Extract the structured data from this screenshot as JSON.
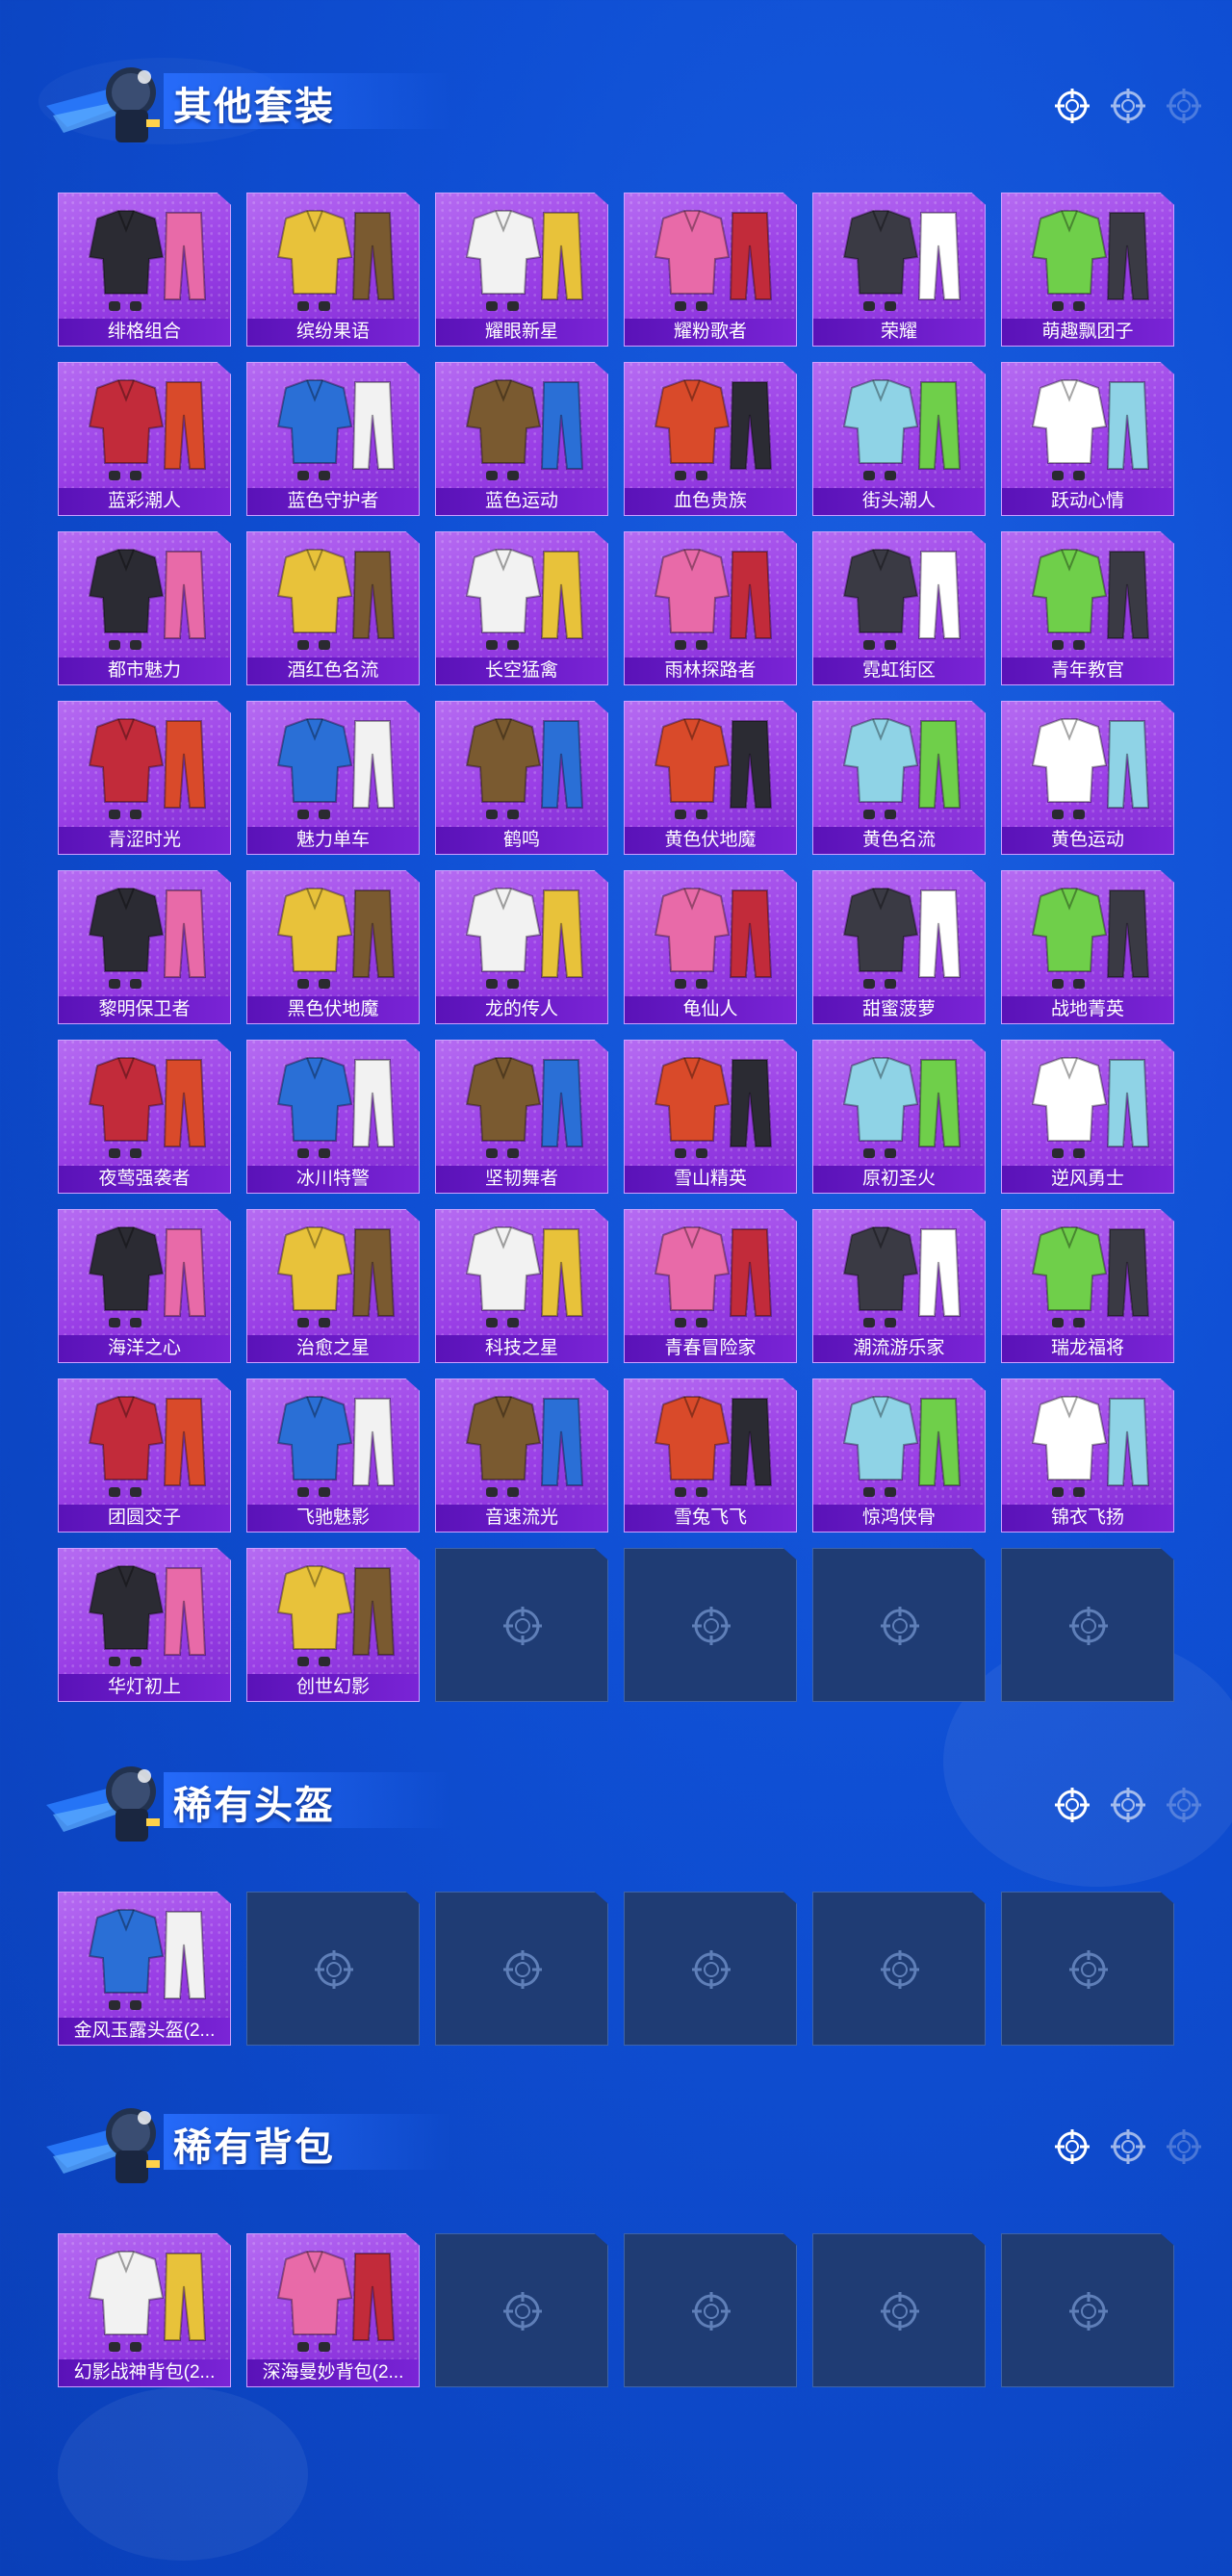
{
  "sections": [
    {
      "title": "其他套装",
      "items": [
        "绯格组合",
        "缤纷果语",
        "耀眼新星",
        "耀粉歌者",
        "荣耀",
        "萌趣飘团子",
        "蓝彩潮人",
        "蓝色守护者",
        "蓝色运动",
        "血色贵族",
        "街头潮人",
        "跃动心情",
        "都市魅力",
        "酒红色名流",
        "长空猛禽",
        "雨林探路者",
        "霓虹街区",
        "青年教官",
        "青涩时光",
        "魅力单车",
        "鹤鸣",
        "黄色伏地魔",
        "黄色名流",
        "黄色运动",
        "黎明保卫者",
        "黑色伏地魔",
        "龙的传人",
        "龟仙人",
        "甜蜜菠萝",
        "战地菁英",
        "夜莺强袭者",
        "冰川特警",
        "坚韧舞者",
        "雪山精英",
        "原初圣火",
        "逆风勇士",
        "海洋之心",
        "治愈之星",
        "科技之星",
        "青春冒险家",
        "潮流游乐家",
        "瑞龙福将",
        "团圆交子",
        "飞驰魅影",
        "音速流光",
        "雪兔飞飞",
        "惊鸿侠骨",
        "锦衣飞扬",
        "华灯初上",
        "创世幻影"
      ],
      "empty_slots": 4
    },
    {
      "title": "稀有头盔",
      "items": [
        "金风玉露头盔(2..."
      ],
      "empty_slots": 5
    },
    {
      "title": "稀有背包",
      "items": [
        "幻影战神背包(2...",
        "深海曼妙背包(2..."
      ],
      "empty_slots": 4
    }
  ],
  "icons": {
    "header_crosshair": "crosshair-icon",
    "empty_slot": "crosshair-icon",
    "mascot": "mascot-icon"
  },
  "colors": {
    "background": "#0f4fd4",
    "card_purple": "#9a3fe6",
    "label_bar": "#6a1cc8",
    "empty_slot": "#1f3c74"
  }
}
